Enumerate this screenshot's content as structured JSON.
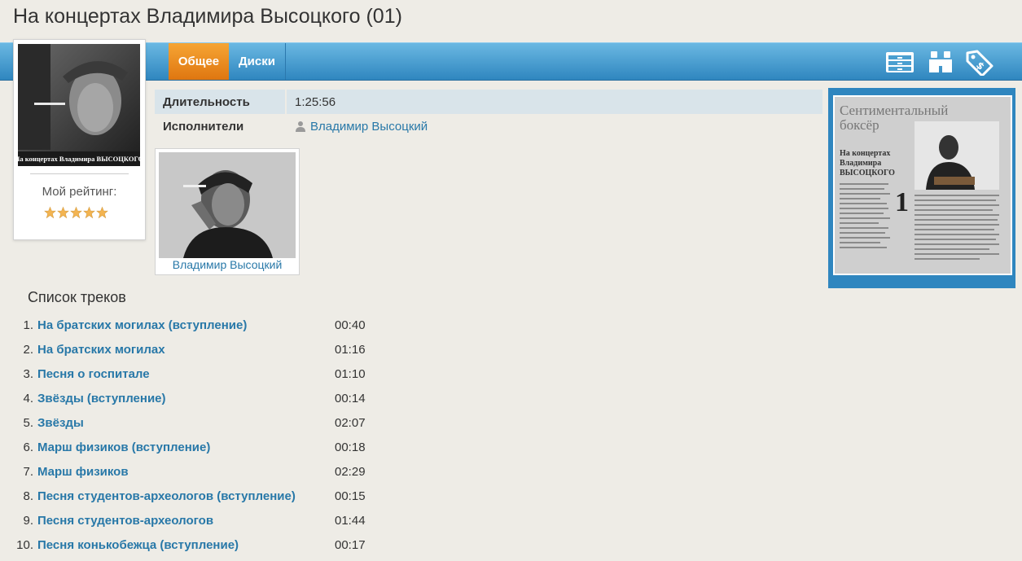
{
  "page": {
    "title": "На концертах Владимира Высоцкого (01)"
  },
  "nav": {
    "tabs": [
      {
        "label": "Общее",
        "active": true
      },
      {
        "label": "Диски",
        "active": false
      }
    ],
    "icons": [
      "cabinet-icon",
      "binoculars-icon",
      "price-tag-icon"
    ],
    "accent": "#2f86bf",
    "active_tab_color": "#e7851c"
  },
  "cover": {
    "cover_caption": "На концертах Владимира ВЫСОЦКОГО",
    "rating_label": "Мой рейтинг:",
    "rating_stars": 5
  },
  "info": {
    "duration_label": "Длительность",
    "duration_value": "1:25:56",
    "performers_label": "Исполнители",
    "performer": "Владимир Высоцкий"
  },
  "artist_card": {
    "name": "Владимир Высоцкий"
  },
  "back_cover": {
    "title_line1": "Сентиментальный",
    "title_line2": "боксёр",
    "subtitle_line1": "На концертах",
    "subtitle_line2": "Владимира",
    "subtitle_line3": "ВЫСОЦКОГО",
    "number": "1"
  },
  "tracks": {
    "heading": "Список треков",
    "items": [
      {
        "num": "1.",
        "title": "На братских могилах (вступление)",
        "duration": "00:40"
      },
      {
        "num": "2.",
        "title": "На братских могилах",
        "duration": "01:16"
      },
      {
        "num": "3.",
        "title": "Песня о госпитале",
        "duration": "01:10"
      },
      {
        "num": "4.",
        "title": "Звёзды (вступление)",
        "duration": "00:14"
      },
      {
        "num": "5.",
        "title": "Звёзды",
        "duration": "02:07"
      },
      {
        "num": "6.",
        "title": "Марш физиков (вступление)",
        "duration": "00:18"
      },
      {
        "num": "7.",
        "title": "Марш физиков",
        "duration": "02:29"
      },
      {
        "num": "8.",
        "title": "Песня студентов-археологов (вступление)",
        "duration": "00:15"
      },
      {
        "num": "9.",
        "title": "Песня студентов-археологов",
        "duration": "01:44"
      },
      {
        "num": "10.",
        "title": "Песня конькобежца (вступление)",
        "duration": "00:17"
      }
    ]
  }
}
